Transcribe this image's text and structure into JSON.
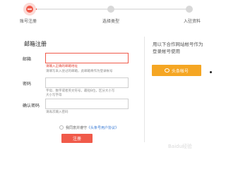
{
  "steps": [
    {
      "label": "账号注册"
    },
    {
      "label": "选择类型"
    },
    {
      "label": "入驻资料"
    }
  ],
  "form": {
    "title": "邮箱注册",
    "email": {
      "label": "邮箱",
      "error": "请输入正确的邮箱地址",
      "hint": "请填写未入驻过的邮箱，此邮箱将作为登录帐号"
    },
    "password": {
      "label": "密码",
      "hint_line1": "字母、数字或者英文符号，最短8位，区分大小写",
      "hint_line2": "大小写字母"
    },
    "confirm": {
      "label": "确认密码",
      "hint": "请再次输入密码"
    },
    "agree_prefix": "我同意并遵守",
    "agree_link": "《头条号用户协议》",
    "submit_label": "注册"
  },
  "sidebar": {
    "text_line1": "用以下合作网站帐号作为",
    "text_line2": "登录帐号使用",
    "toutiao_button": "头条帐号"
  },
  "watermark": "Baidu经验",
  "colors": {
    "accent": "#f05a4a",
    "orange": "#f5a623",
    "step_inactive": "#d8d8d8"
  }
}
